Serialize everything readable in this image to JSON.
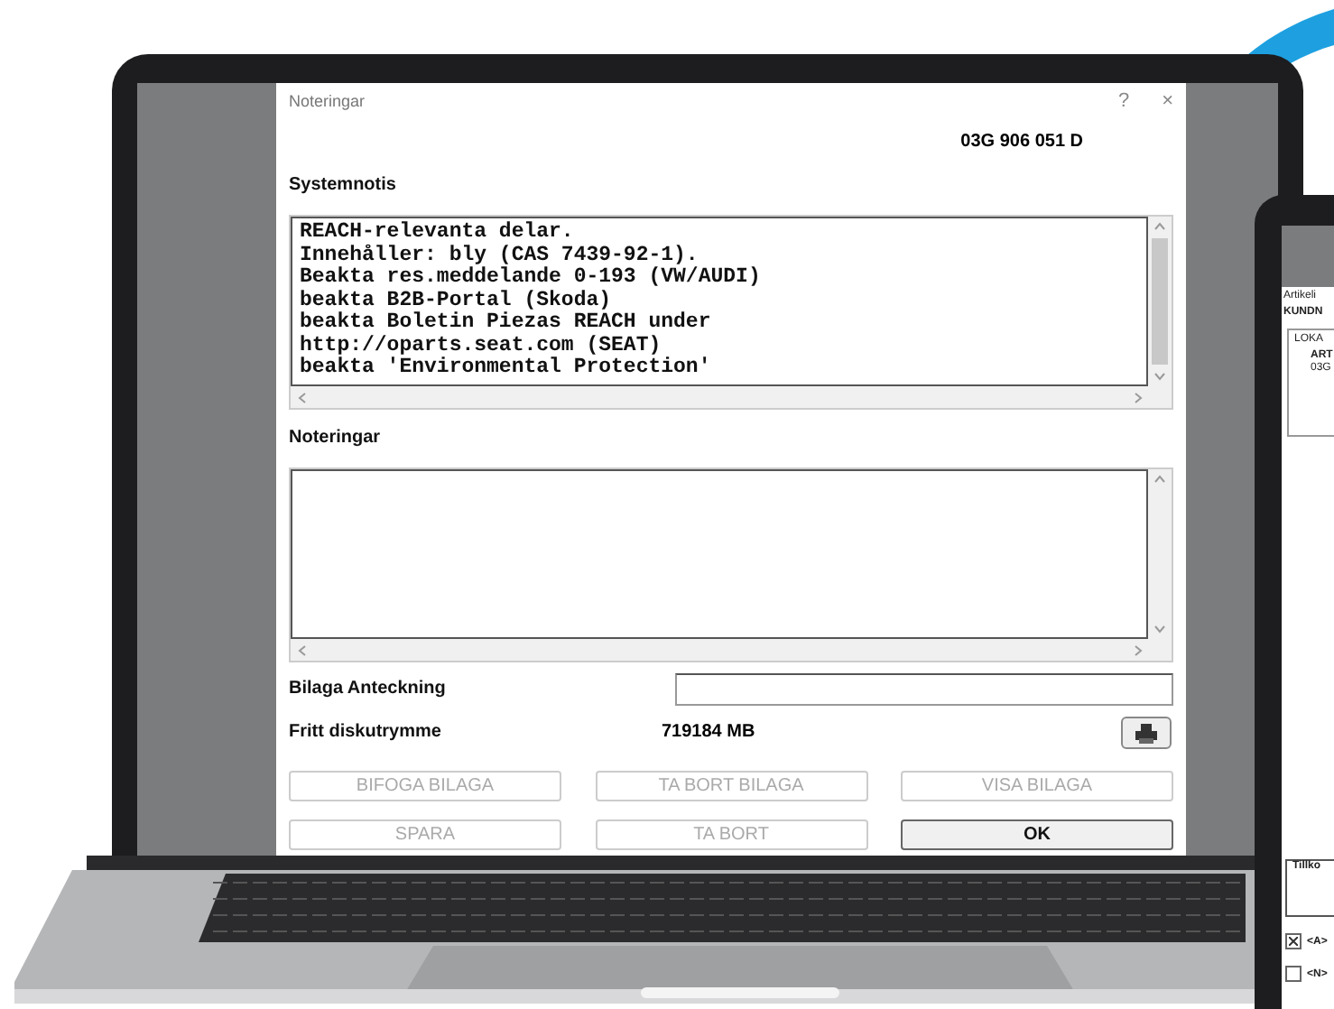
{
  "dialog": {
    "title": "Noteringar",
    "help": "?",
    "close": "×",
    "part_number": "03G 906 051 D",
    "system_note": {
      "label": "Systemnotis",
      "lines": [
        "REACH-relevanta delar.",
        "Innehåller: bly (CAS 7439-92-1).",
        "Beakta res.meddelande 0-193 (VW/AUDI)",
        "beakta B2B-Portal (Skoda)",
        "beakta Boletin Piezas REACH under",
        "http://oparts.seat.com (SEAT)",
        "beakta 'Environmental Protection'"
      ]
    },
    "notes": {
      "label": "Noteringar"
    },
    "attachment_note": {
      "label": "Bilaga Anteckning"
    },
    "free_space": {
      "label": "Fritt diskutrymme",
      "value": "719184 MB"
    },
    "buttons": [
      {
        "label": "BIFOGA BILAGA",
        "disabled": true
      },
      {
        "label": "TA BORT BILAGA",
        "disabled": true
      },
      {
        "label": "VISA BILAGA",
        "disabled": true
      },
      {
        "label": "SPARA",
        "disabled": true
      },
      {
        "label": "TA BORT",
        "disabled": true
      },
      {
        "label": "OK",
        "disabled": false
      }
    ]
  },
  "second_screen": {
    "title": "Artikeli",
    "header": "KUNDN",
    "tab": "LOKA",
    "column": "ART",
    "cell": "03G",
    "group": "Tillko",
    "checkboxes": [
      {
        "label": "<A>",
        "checked": true
      },
      {
        "label": "<N>",
        "checked": false
      }
    ]
  }
}
